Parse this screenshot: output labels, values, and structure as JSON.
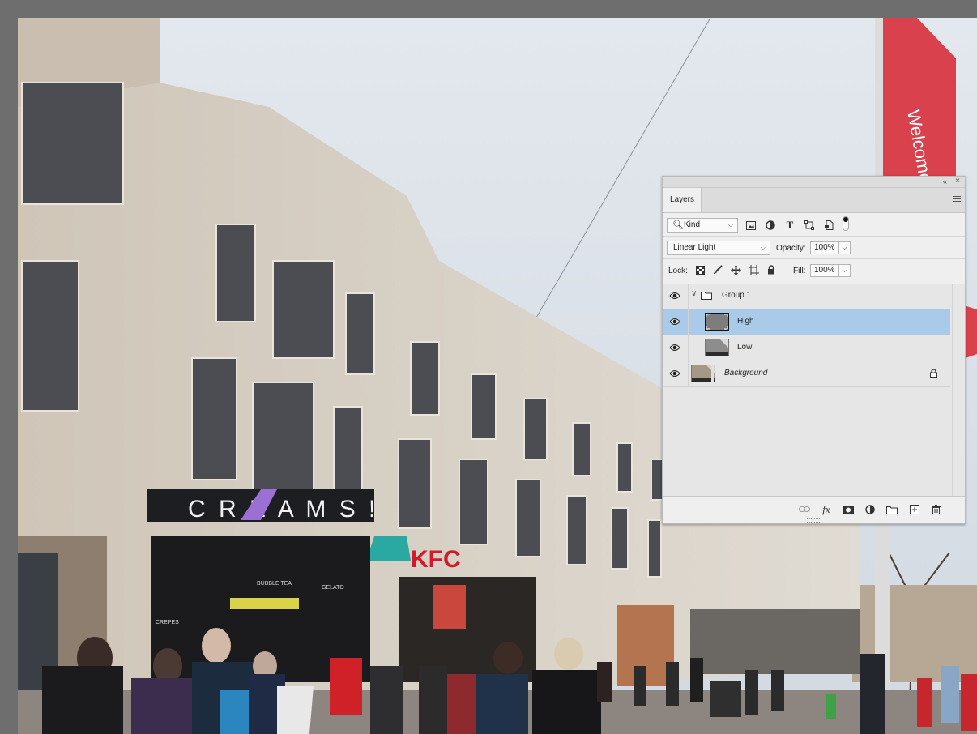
{
  "panel": {
    "tab": "Layers",
    "filter": {
      "kind_label": "Kind",
      "icons": [
        "pixel-filter-icon",
        "adjustment-filter-icon",
        "type-filter-icon",
        "shape-filter-icon",
        "smart-object-filter-icon",
        "filter-toggle-icon"
      ]
    },
    "blend_mode": "Linear Light",
    "opacity_label": "Opacity:",
    "opacity_value": "100%",
    "lock_label": "Lock:",
    "fill_label": "Fill:",
    "fill_value": "100%",
    "layers": [
      {
        "name": "Group 1",
        "type": "group",
        "visible": true,
        "selected": false
      },
      {
        "name": "High",
        "type": "layer",
        "visible": true,
        "selected": true,
        "indented": true
      },
      {
        "name": "Low",
        "type": "layer",
        "visible": true,
        "selected": false,
        "indented": true
      },
      {
        "name": "Background",
        "type": "background",
        "visible": true,
        "selected": false,
        "locked": true
      }
    ],
    "footer_fx": "fx"
  },
  "photo": {
    "shop_sign": "C R E A M S !",
    "kfc_sign": "KFC",
    "banner_text": "Welcome",
    "small_signs": [
      "BUBBLE TEA",
      "GELATO",
      "CREPES"
    ]
  },
  "colors": {
    "selected_row": "#a9cbe9",
    "banner": "#d9414c",
    "kfc_red": "#d3192a",
    "sky": "#dfe5ec"
  }
}
